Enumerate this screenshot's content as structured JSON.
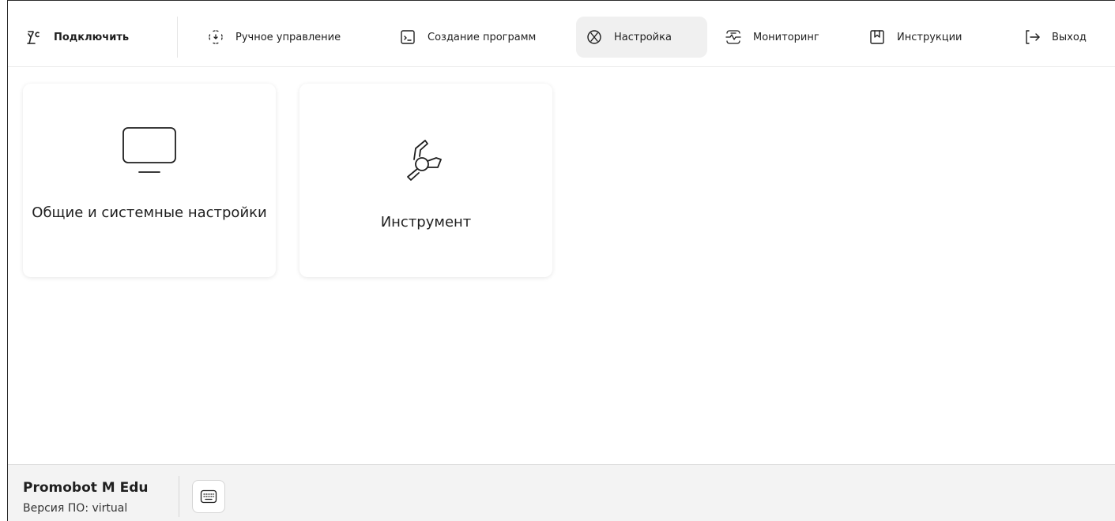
{
  "nav": {
    "connect": {
      "label": "Подключить",
      "icon": "robot-arm-connect-icon"
    },
    "items": [
      {
        "label": "Ручное управление",
        "icon": "manual-control-icon",
        "active": false
      },
      {
        "label": "Создание программ",
        "icon": "terminal-icon",
        "active": false
      },
      {
        "label": "Настройка",
        "icon": "settings-icon",
        "active": true
      },
      {
        "label": "Мониторинг",
        "icon": "monitoring-icon",
        "active": false
      },
      {
        "label": "Инструкции",
        "icon": "bookmark-icon",
        "active": false
      },
      {
        "label": "Выход",
        "icon": "logout-icon",
        "active": false
      }
    ]
  },
  "cards": [
    {
      "label": "Общие и системные настройки",
      "icon": "monitor-icon"
    },
    {
      "label": "Инструмент",
      "icon": "robot-tool-icon"
    }
  ],
  "footer": {
    "device_name": "Promobot M Edu",
    "version": "Версия ПО: virtual",
    "keyboard_icon": "keyboard-icon"
  },
  "colors": {
    "active_nav_bg": "#f0f0f0",
    "footer_bg": "#f3f3f3",
    "text": "#1f1f1f"
  }
}
